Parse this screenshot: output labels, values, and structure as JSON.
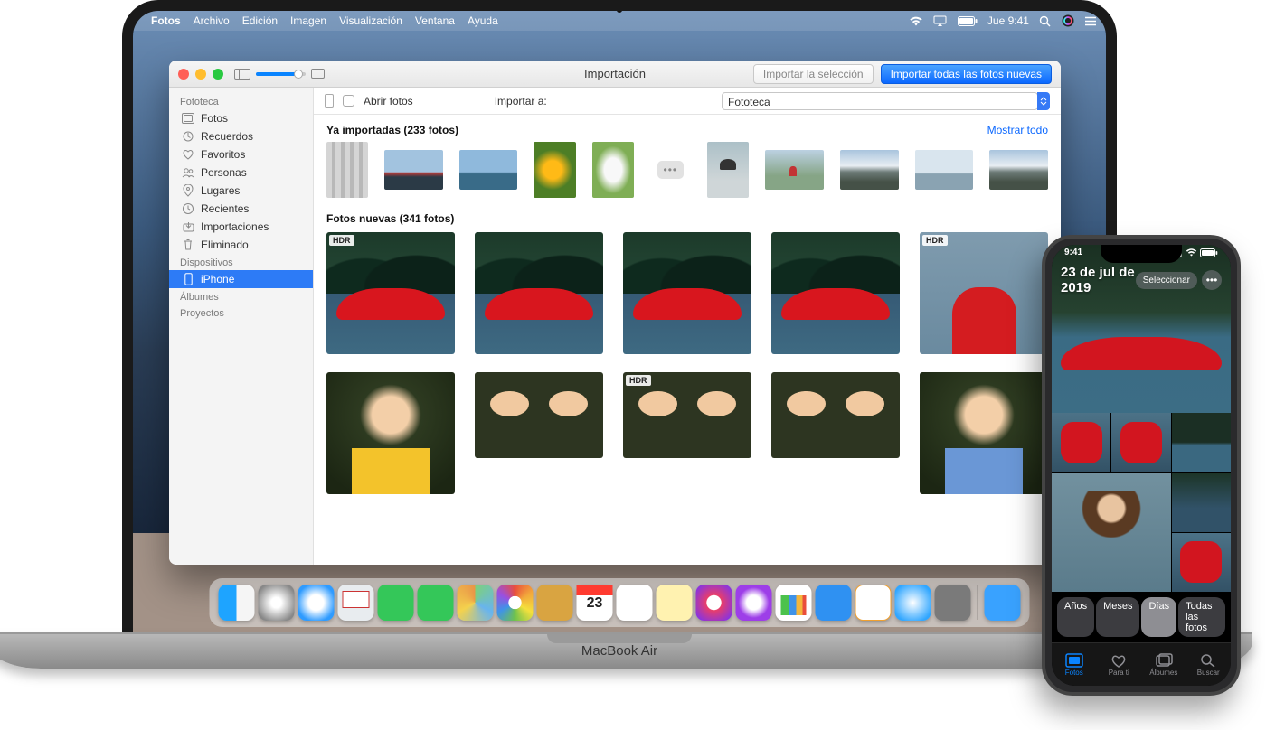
{
  "menubar": {
    "app": "Fotos",
    "items": [
      "Archivo",
      "Edición",
      "Imagen",
      "Visualización",
      "Ventana",
      "Ayuda"
    ],
    "clock": "Jue 9:41"
  },
  "window": {
    "title": "Importación",
    "import_selection": "Importar la selección",
    "import_all_new": "Importar todas las fotos nuevas",
    "open_photos_label": "Abrir fotos",
    "import_to_label": "Importar a:",
    "import_to_value": "Fototeca",
    "already_imported_label": "Ya importadas (233 fotos)",
    "show_all": "Mostrar todo",
    "new_photos_label": "Fotos nuevas (341 fotos)",
    "hdr_tag": "HDR"
  },
  "sidebar": {
    "headers": {
      "fototeca": "Fototeca",
      "dispositivos": "Dispositivos",
      "albumes": "Álbumes",
      "proyectos": "Proyectos"
    },
    "fototeca": [
      {
        "label": "Fotos"
      },
      {
        "label": "Recuerdos"
      },
      {
        "label": "Favoritos"
      },
      {
        "label": "Personas"
      },
      {
        "label": "Lugares"
      },
      {
        "label": "Recientes"
      },
      {
        "label": "Importaciones"
      },
      {
        "label": "Eliminado"
      }
    ],
    "dispositivos": [
      {
        "label": "iPhone"
      }
    ]
  },
  "dock": {
    "cal_month": "JUL",
    "cal_day": "23"
  },
  "macbook_label": "MacBook Air",
  "iphone": {
    "time": "9:41",
    "date": "23 de jul de 2019",
    "select": "Seleccionar",
    "segments": [
      "Años",
      "Meses",
      "Días",
      "Todas las fotos"
    ],
    "selected_segment": 2,
    "tabs": [
      {
        "label": "Fotos"
      },
      {
        "label": "Para ti"
      },
      {
        "label": "Álbumes"
      },
      {
        "label": "Buscar"
      }
    ]
  }
}
